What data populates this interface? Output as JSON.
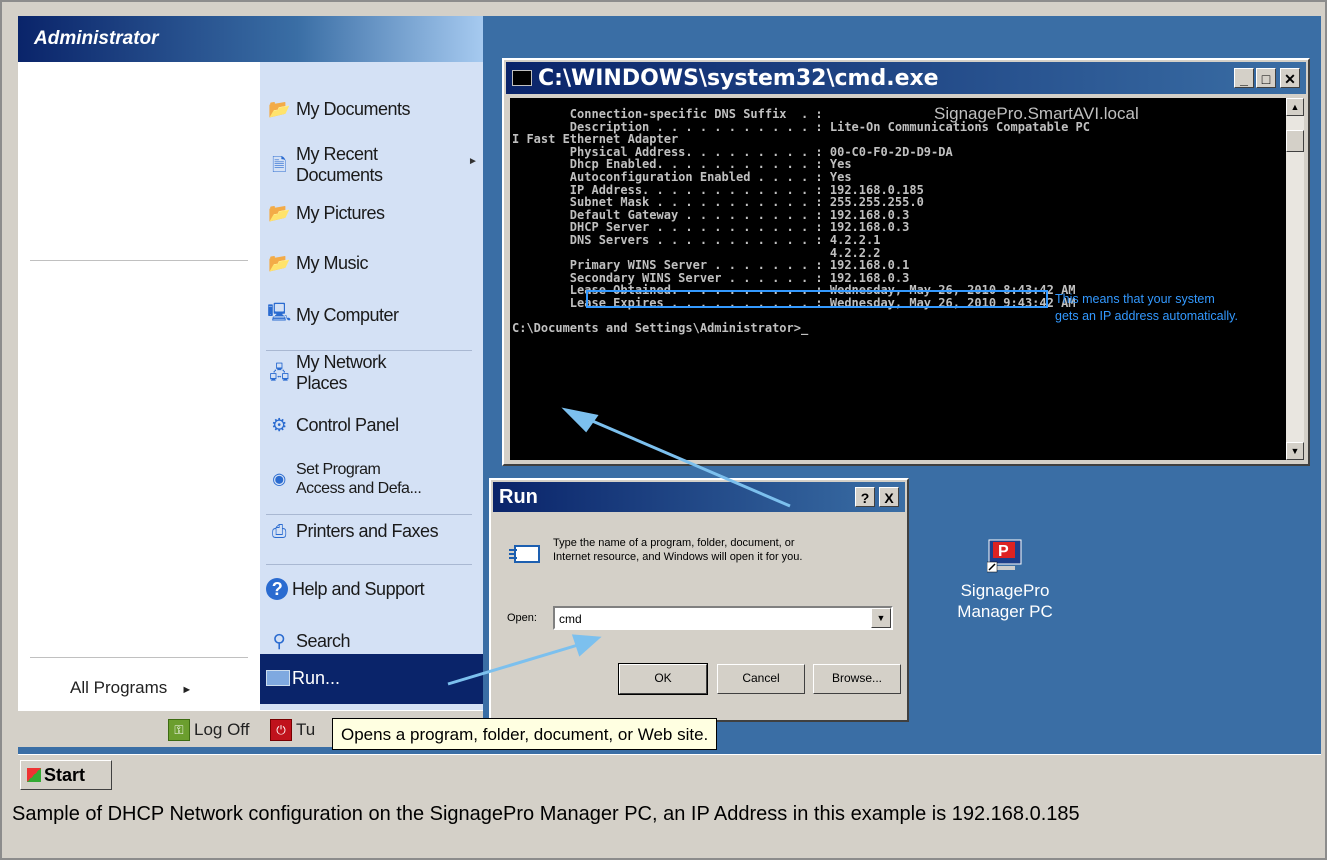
{
  "start_menu": {
    "user_name": "Administrator",
    "all_programs": "All Programs",
    "right_items": [
      {
        "label": "My Documents",
        "icon": "folder-icon"
      },
      {
        "label": "My Recent\nDocuments",
        "icon": "recent-documents-icon"
      },
      {
        "label": "My Pictures",
        "icon": "folder-icon"
      },
      {
        "label": "My Music",
        "icon": "folder-icon"
      },
      {
        "label": "My Computer",
        "icon": "computer-icon"
      },
      {
        "label": "My Network\nPlaces",
        "icon": "network-icon"
      },
      {
        "label": "Control Panel",
        "icon": "control-panel-icon"
      },
      {
        "label": "Set Program\nAccess and Defa...",
        "icon": "globe-icon"
      },
      {
        "label": "Printers and Faxes",
        "icon": "printer-icon"
      },
      {
        "label": "Help and Support",
        "icon": "help-icon"
      },
      {
        "label": "Search",
        "icon": "search-icon"
      },
      {
        "label": "Run...",
        "icon": "run-icon"
      }
    ],
    "log_off": "Log Off",
    "turn_off": "Tu"
  },
  "tooltip": "Opens a program, folder, document, or Web site.",
  "taskbar": {
    "start_label": "Start"
  },
  "cmd": {
    "title": "C:\\WINDOWS\\system32\\cmd.exe",
    "suffix_value": "SignagePro.SmartAVI.local",
    "lines": [
      "        Connection-specific DNS Suffix  . :",
      "        Description . . . . . . . . . . . : Lite-On Communications Compatable PC",
      "I Fast Ethernet Adapter",
      "        Physical Address. . . . . . . . . : 00-C0-F0-2D-D9-DA",
      "        Dhcp Enabled. . . . . . . . . . . : Yes",
      "        Autoconfiguration Enabled . . . . : Yes",
      "        IP Address. . . . . . . . . . . . : 192.168.0.185",
      "        Subnet Mask . . . . . . . . . . . : 255.255.255.0",
      "        Default Gateway . . . . . . . . . : 192.168.0.3",
      "        DHCP Server . . . . . . . . . . . : 192.168.0.3",
      "        DNS Servers . . . . . . . . . . . : 4.2.2.1",
      "                                            4.2.2.2",
      "        Primary WINS Server . . . . . . . : 192.168.0.1",
      "        Secondary WINS Server . . . . . . : 192.168.0.3",
      "        Lease Obtained. . . . . . . . . . : Wednesday, May 26, 2010 8:43:42 AM",
      "        Lease Expires . . . . . . . . . . : Wednesday, May 26, 2010 9:43:42 AM",
      "",
      "C:\\Documents and Settings\\Administrator>_"
    ],
    "annotation": "This means that your system\ngets an IP address automatically."
  },
  "run_dialog": {
    "title": "Run",
    "description": "Type the name of a program, folder, document, or\nInternet resource, and Windows will open it for you.",
    "open_label": "Open:",
    "open_value": "cmd",
    "ok": "OK",
    "cancel": "Cancel",
    "browse": "Browse...",
    "help_btn": "?",
    "close_btn": "X"
  },
  "desktop_icon": {
    "label": "SignagePro\nManager PC"
  },
  "caption": "Sample of DHCP Network configuration on the SignagePro Manager PC, an IP Address in this example is 192.168.0.185",
  "colors": {
    "title_bar": "#0a246a",
    "desktop": "#3a6ea5",
    "annotation": "#3399ff",
    "menu_right": "#d4e1f5"
  }
}
